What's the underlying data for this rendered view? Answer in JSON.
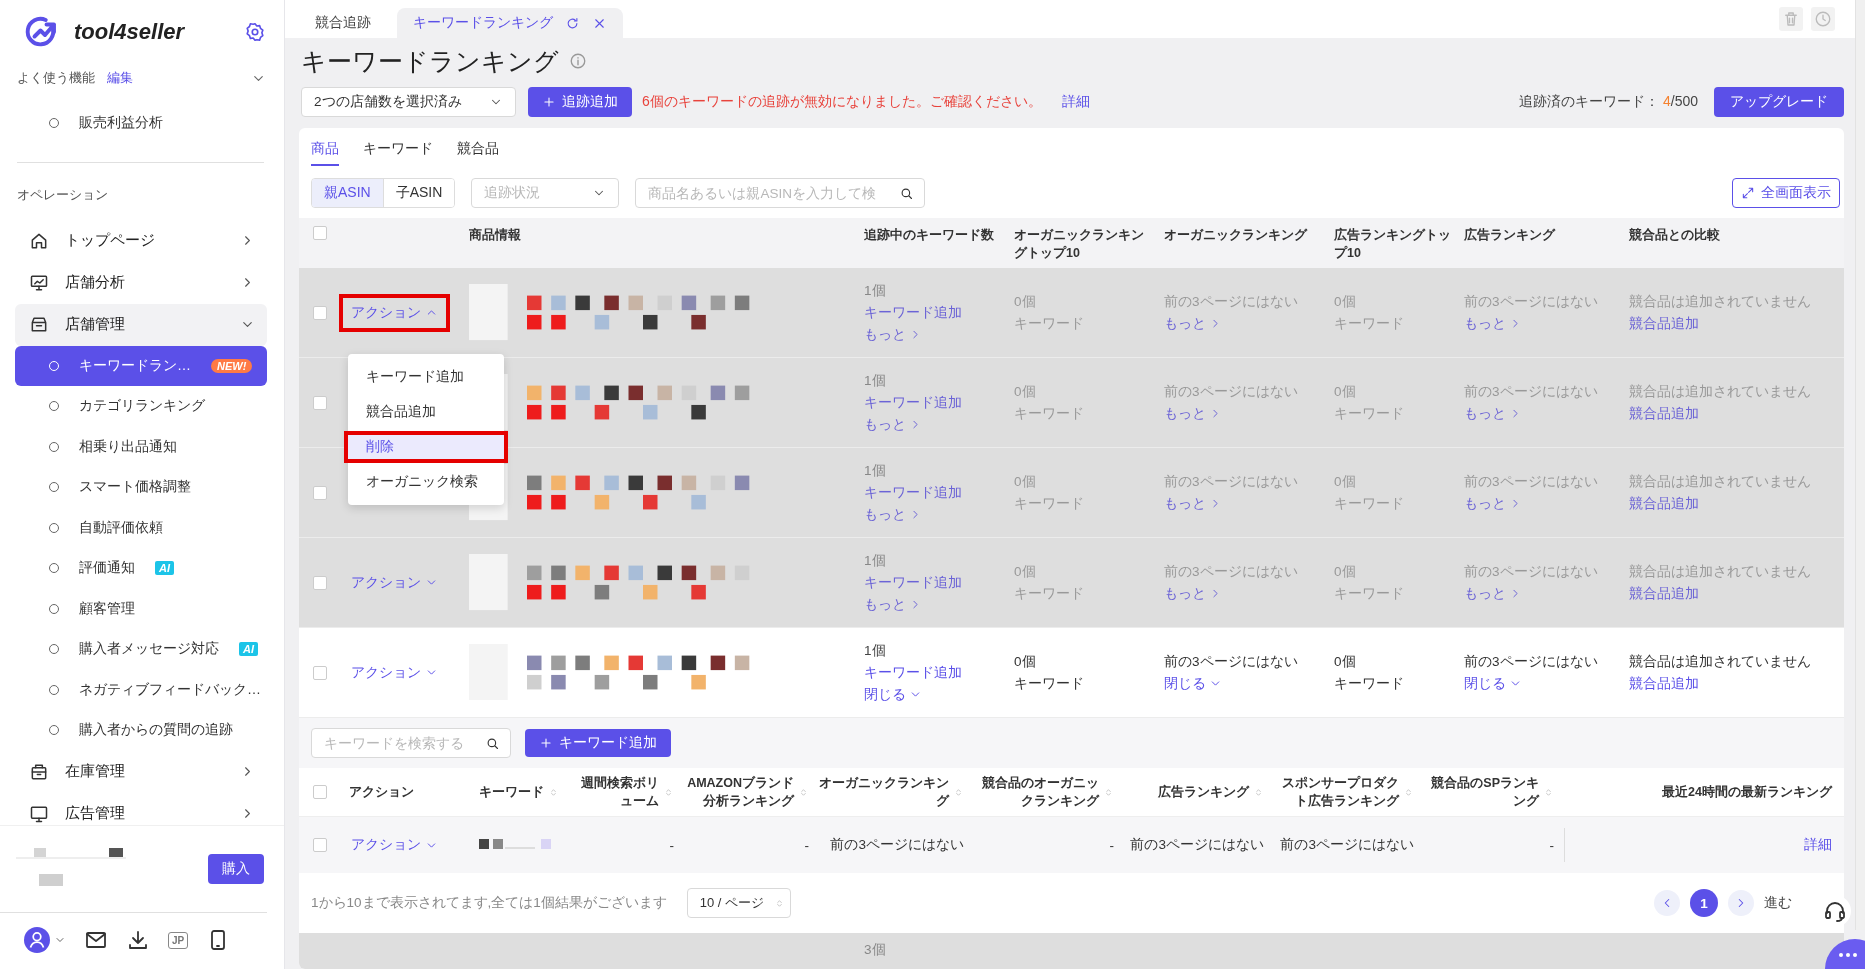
{
  "sidebar": {
    "brand": "tool4seller",
    "favorites": {
      "label": "よく使う機能",
      "edit": "編集",
      "expanded": true,
      "items": [
        {
          "label": "販売利益分析"
        }
      ]
    },
    "section_title": "オペレーション",
    "nav": [
      {
        "label": "トップページ",
        "expanded": false
      },
      {
        "label": "店舗分析",
        "expanded": false
      },
      {
        "label": "店舗管理",
        "expanded": true,
        "children": [
          {
            "label": "キーワードラン…",
            "selected": true,
            "badge": {
              "text": "NEW!",
              "kind": "new"
            }
          },
          {
            "label": "カテゴリランキング",
            "selected": false
          },
          {
            "label": "相乗り出品通知",
            "selected": false
          },
          {
            "label": "スマート価格調整",
            "selected": false
          },
          {
            "label": "自動評価依頼",
            "selected": false
          },
          {
            "label": "評価通知",
            "selected": false,
            "badge": {
              "text": "AI",
              "kind": "ai"
            }
          },
          {
            "label": "顧客管理",
            "selected": false
          },
          {
            "label": "購入者メッセージ対応",
            "selected": false,
            "badge": {
              "text": "AI",
              "kind": "ai"
            }
          },
          {
            "label": "ネガティブフィードバック…",
            "selected": false
          },
          {
            "label": "購入者からの質問の追跡",
            "selected": false
          }
        ]
      },
      {
        "label": "在庫管理",
        "expanded": false
      },
      {
        "label": "広告管理",
        "expanded": false
      }
    ],
    "purchase_button": "購入",
    "footer": {
      "language": "JP"
    }
  },
  "tabs": [
    {
      "label": "競合追跡",
      "selected": false
    },
    {
      "label": "キーワードランキング",
      "selected": true
    }
  ],
  "page": {
    "title": "キーワードランキング",
    "store_select": "2つの店舗数を選択済み",
    "add_button": "追跡追加",
    "warning": "6個のキーワードの追跡が無効になりました。ご確認ください。",
    "warning_link": "詳細",
    "tracked_label": "追跡済のキーワード：",
    "tracked_count": "4",
    "tracked_total": "/500",
    "upgrade_button": "アップグレード"
  },
  "view_tabs": [
    {
      "label": "商品",
      "selected": true
    },
    {
      "label": "キーワード",
      "selected": false
    },
    {
      "label": "競合品",
      "selected": false
    }
  ],
  "asin_toggle": [
    {
      "label": "親ASIN",
      "selected": true
    },
    {
      "label": "子ASIN",
      "selected": false
    }
  ],
  "status_filter": {
    "placeholder": "追跡状況"
  },
  "search": {
    "placeholder": "商品名あるいは親ASINを入力して検"
  },
  "fullscreen_button": "全画面表示",
  "table": {
    "select_all_checked": false,
    "columns": [
      "商品情報",
      "追跡中のキーワード数",
      "オーガニックランキングトップ10",
      "オーガニックランキング",
      "広告ランキングトップ10",
      "広告ランキング",
      "競合品との比較"
    ],
    "rows": [
      {
        "dimmed": true,
        "checked": false,
        "action": "アクション",
        "action_open": true,
        "annotated": true,
        "keyword_count": "1個",
        "add_keyword": "キーワード追加",
        "toggle": "もっと",
        "expanded": false,
        "organic_top10": "0個",
        "organic_top10_unit": "キーワード",
        "organic_rank": "前の3ページにはない",
        "organic_toggle": "もっと",
        "ad_top10": "0個",
        "ad_top10_unit": "キーワード",
        "ad_rank": "前の3ページにはない",
        "ad_toggle": "もっと",
        "competitor": "競合品は追加されていません",
        "add_competitor": "競合品追加"
      },
      {
        "dimmed": true,
        "checked": false,
        "keyword_count": "1個",
        "add_keyword": "キーワード追加",
        "toggle": "もっと",
        "expanded": false,
        "organic_top10": "0個",
        "organic_top10_unit": "キーワード",
        "organic_rank": "前の3ページにはない",
        "organic_toggle": "もっと",
        "ad_top10": "0個",
        "ad_top10_unit": "キーワード",
        "ad_rank": "前の3ページにはない",
        "ad_toggle": "もっと",
        "competitor": "競合品は追加されていません",
        "add_competitor": "競合品追加"
      },
      {
        "dimmed": true,
        "checked": false,
        "keyword_count": "1個",
        "add_keyword": "キーワード追加",
        "toggle": "もっと",
        "expanded": false,
        "organic_top10": "0個",
        "organic_top10_unit": "キーワード",
        "organic_rank": "前の3ページにはない",
        "organic_toggle": "もっと",
        "ad_top10": "0個",
        "ad_top10_unit": "キーワード",
        "ad_rank": "前の3ページにはない",
        "ad_toggle": "もっと",
        "competitor": "競合品は追加されていません",
        "add_competitor": "競合品追加"
      },
      {
        "dimmed": true,
        "checked": false,
        "action": "アクション",
        "action_open": false,
        "annotated": false,
        "keyword_count": "1個",
        "add_keyword": "キーワード追加",
        "toggle": "もっと",
        "expanded": false,
        "organic_top10": "0個",
        "organic_top10_unit": "キーワード",
        "organic_rank": "前の3ページにはない",
        "organic_toggle": "もっと",
        "ad_top10": "0個",
        "ad_top10_unit": "キーワード",
        "ad_rank": "前の3ページにはない",
        "ad_toggle": "もっと",
        "competitor": "競合品は追加されていません",
        "add_competitor": "競合品追加"
      },
      {
        "dimmed": false,
        "checked": false,
        "action": "アクション",
        "action_open": false,
        "annotated": false,
        "keyword_count": "1個",
        "add_keyword": "キーワード追加",
        "toggle": "閉じる",
        "expanded": true,
        "organic_top10": "0個",
        "organic_top10_unit": "キーワード",
        "organic_rank": "前の3ページにはない",
        "organic_toggle": "閉じる",
        "ad_top10": "0個",
        "ad_top10_unit": "キーワード",
        "ad_rank": "前の3ページにはない",
        "ad_toggle": "閉じる",
        "competitor": "競合品は追加されていません",
        "add_competitor": "競合品追加",
        "keyword_table": {
          "search_placeholder": "キーワードを検索する",
          "add_button": "キーワード追加",
          "select_all_checked": false,
          "columns": [
            {
              "label": "アクション",
              "sortable": false
            },
            {
              "label": "キーワード",
              "sortable": true
            },
            {
              "label": "週間検索ボリューム",
              "sortable": true
            },
            {
              "label": "AMAZONブランド分析ランキング",
              "sortable": true
            },
            {
              "label": "オーガニックランキング",
              "sortable": true
            },
            {
              "label": "競合品のオーガニックランキング",
              "sortable": true
            },
            {
              "label": "広告ランキング",
              "sortable": true
            },
            {
              "label": "スポンサープロダクト広告ランキング",
              "sortable": true
            },
            {
              "label": "競合品のSPランキング",
              "sortable": true
            },
            {
              "label": "最近24時間の最新ランキング",
              "sortable": false
            }
          ],
          "rows": [
            {
              "checked": false,
              "cells": [
                "アクション",
                "",
                "-",
                "-",
                "前の3ページにはない",
                "-",
                "前の3ページにはない",
                "前の3ページにはない",
                "-",
                "詳細"
              ]
            }
          ],
          "pagination": {
            "summary": "1から10まで表示されてます,全ては1個結果がございます",
            "page_size": "10 / ページ",
            "pages": [
              {
                "label": "1",
                "selected": true
              }
            ],
            "goto": "進む"
          }
        }
      }
    ],
    "tail_row": {
      "keyword_count": "3個"
    }
  },
  "action_menu": {
    "items": [
      {
        "label": "キーワード追加",
        "selected": false,
        "annotated": false
      },
      {
        "label": "競合品追加",
        "selected": false,
        "annotated": false
      },
      {
        "label": "削除",
        "selected": true,
        "annotated": true
      },
      {
        "label": "オーガニック検索",
        "selected": false,
        "annotated": false
      }
    ]
  }
}
